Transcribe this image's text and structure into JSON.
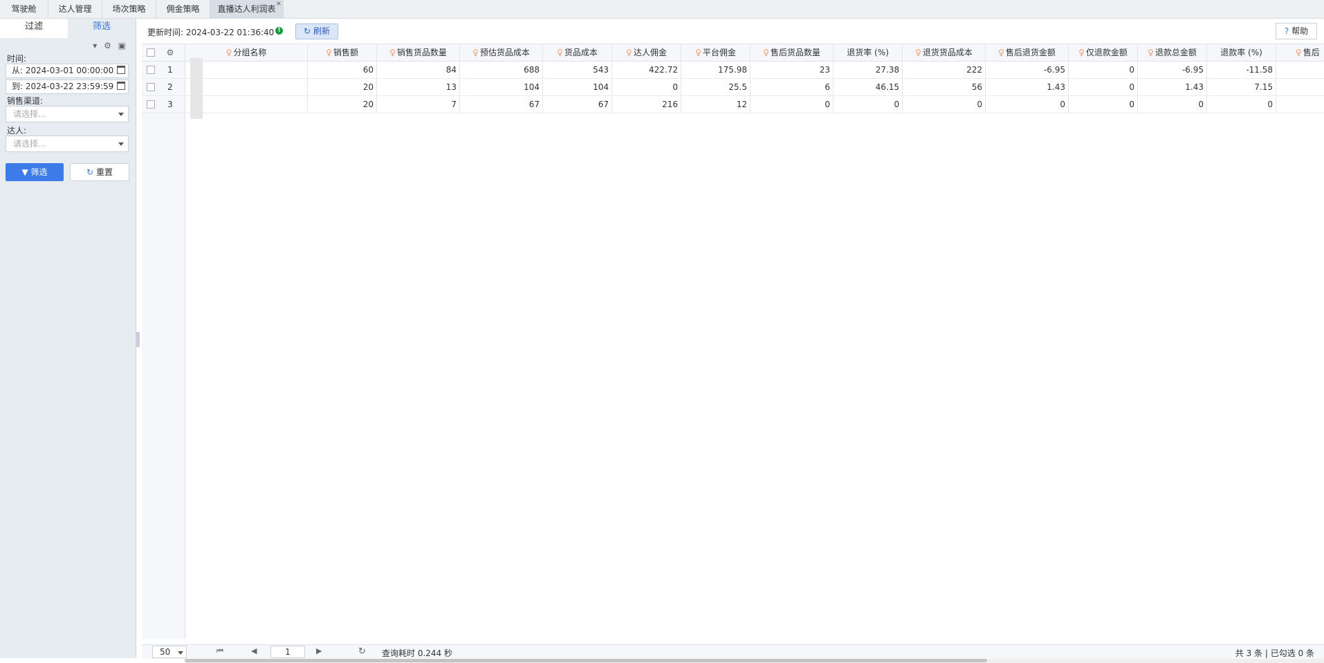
{
  "tabs": [
    {
      "label": "驾驶舱"
    },
    {
      "label": "达人管理"
    },
    {
      "label": "场次策略"
    },
    {
      "label": "佣金策略"
    },
    {
      "label": "直播达人利润表",
      "active": true
    }
  ],
  "sidebar": {
    "tab_filter": "过滤",
    "tab_screen": "筛选",
    "time_label": "时间:",
    "from_value": "从: 2024-03-01 00:00:00",
    "to_value": "到: 2024-03-22 23:59:59",
    "channel_label": "销售渠道:",
    "channel_placeholder": "请选择...",
    "talent_label": "达人:",
    "talent_placeholder": "请选择...",
    "filter_button": "筛选",
    "reset_button": "重置"
  },
  "toolbar": {
    "update_time": "更新时间: 2024-03-22 01:36:40",
    "refresh_label": "刷新",
    "help_label": "帮助"
  },
  "table": {
    "headers": [
      "分组名称",
      "销售额",
      "销售货品数量",
      "预估货品成本",
      "货品成本",
      "达人佣金",
      "平台佣金",
      "售后货品数量",
      "退货率 (%)",
      "退货货品成本",
      "售后退货金额",
      "仅退款金额",
      "退款总金额",
      "退款率 (%)",
      "售后"
    ],
    "rows": [
      {
        "num": "1",
        "cells": [
          "",
          "60",
          "84",
          "688",
          "543",
          "422.72",
          "175.98",
          "23",
          "27.38",
          "222",
          "-6.95",
          "0",
          "-6.95",
          "-11.58",
          ""
        ]
      },
      {
        "num": "2",
        "cells": [
          "",
          "20",
          "13",
          "104",
          "104",
          "0",
          "25.5",
          "6",
          "46.15",
          "56",
          "1.43",
          "0",
          "1.43",
          "7.15",
          ""
        ]
      },
      {
        "num": "3",
        "cells": [
          "",
          "20",
          "7",
          "67",
          "67",
          "216",
          "12",
          "0",
          "0",
          "0",
          "0",
          "0",
          "0",
          "0",
          ""
        ]
      }
    ]
  },
  "footer": {
    "page_size": "50",
    "page_number": "1",
    "query_time": "查询耗时 0.244 秒",
    "summary": "共 3 条 | 已勾选 0 条"
  },
  "colors": {
    "accent": "#3c7be8",
    "ok": "#1a9c3b",
    "bulb": "#f09a6a"
  }
}
